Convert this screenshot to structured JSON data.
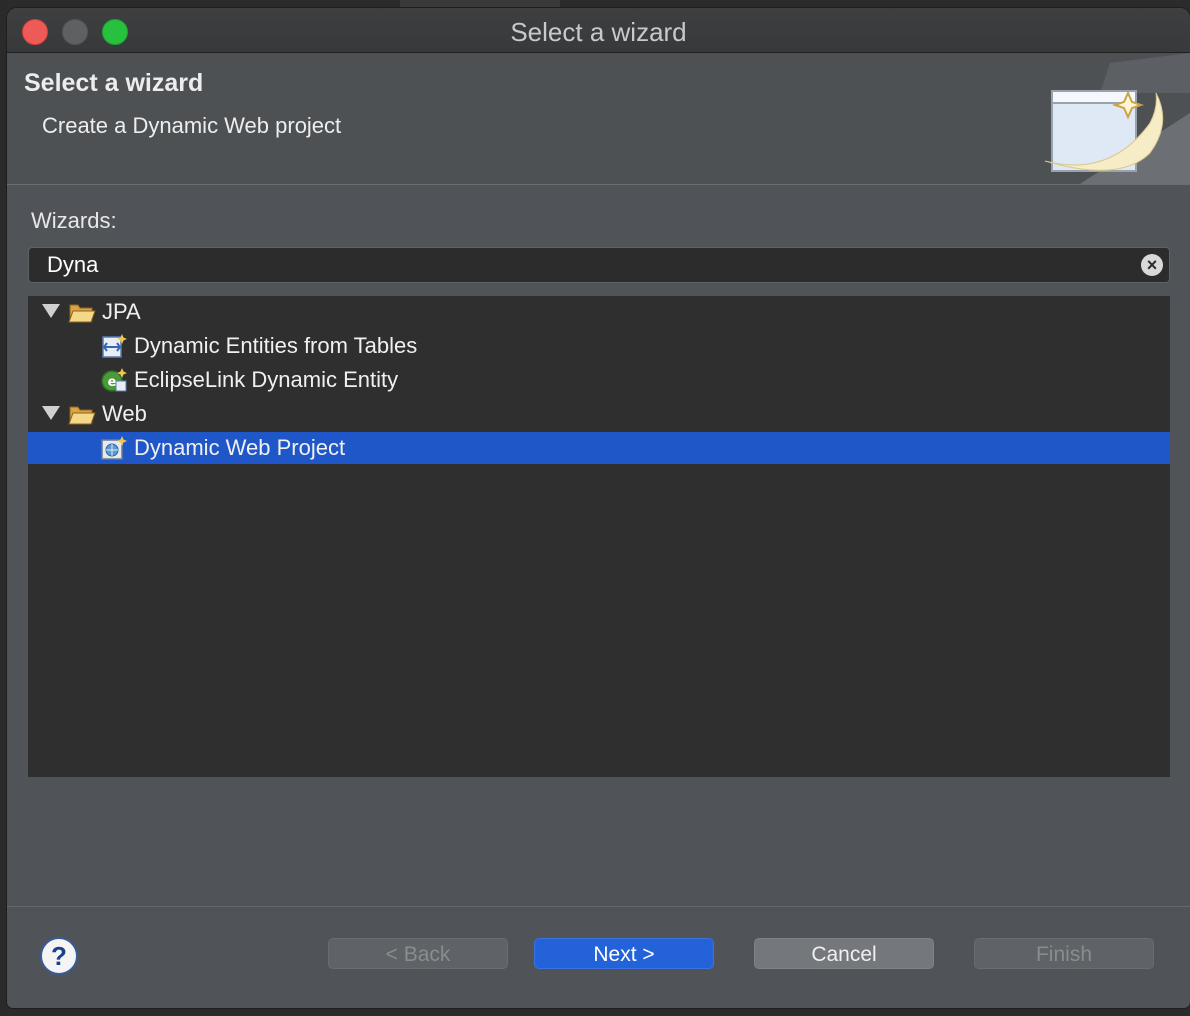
{
  "window": {
    "title": "Select a wizard"
  },
  "header": {
    "title": "Select a wizard",
    "subtitle": "Create a Dynamic Web project"
  },
  "wizards": {
    "label": "Wizards:",
    "filter_value": "Dyna",
    "tree": [
      {
        "label": "JPA",
        "type": "category",
        "expanded": true,
        "icon": "folder-open-icon"
      },
      {
        "label": "Dynamic Entities from Tables",
        "type": "wizard",
        "icon": "entities-wizard-icon"
      },
      {
        "label": "EclipseLink Dynamic Entity",
        "type": "wizard",
        "icon": "eclipselink-entity-icon"
      },
      {
        "label": "Web",
        "type": "category",
        "expanded": true,
        "icon": "folder-open-icon"
      },
      {
        "label": "Dynamic Web Project",
        "type": "wizard",
        "icon": "web-project-icon",
        "selected": true
      }
    ]
  },
  "buttons": {
    "back": "< Back",
    "next": "Next >",
    "cancel": "Cancel",
    "finish": "Finish"
  },
  "help": {
    "glyph": "?"
  },
  "colors": {
    "selection": "#1f57c8",
    "primary_button": "#2362d8",
    "dialog_bg": "#505357"
  }
}
